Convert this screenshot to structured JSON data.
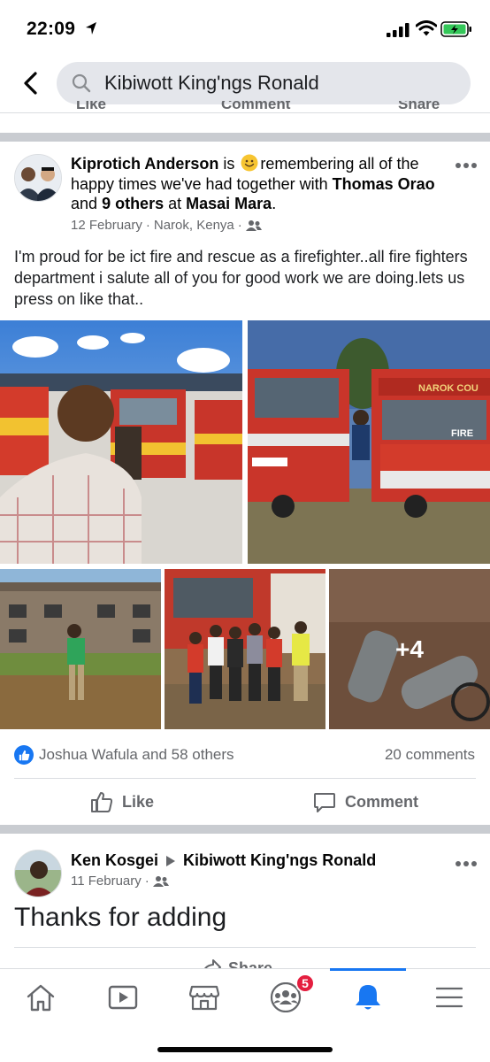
{
  "status_bar": {
    "time": "22:09"
  },
  "search": {
    "query": "Kibiwott King'ngs Ronald"
  },
  "previous_post_actions": {
    "like": "Like",
    "comment": "Comment",
    "share": "Share"
  },
  "post": {
    "author": "Kiprotich Anderson",
    "verb_is": "is",
    "feeling": "remembering all of the happy times we've had together with",
    "tagged": "Thomas Orao",
    "and_word": "and",
    "others": "9 others",
    "at_word": "at",
    "place": "Masai Mara",
    "period": ".",
    "date": "12 February",
    "location": "Narok, Kenya",
    "dot": "·",
    "body": "I'm proud  for be ict fire and rescue as a firefighter..all fire fighters  department i salute all of you for good work we are doing.lets us press on like that..",
    "photos": {
      "truck_text_1": "NAROK COU",
      "truck_text_2": "FIRE",
      "more_count": "+4"
    },
    "reactions_text": "Joshua Wafula and 58 others",
    "comments_text": "20 comments",
    "like_label": "Like",
    "comment_label": "Comment"
  },
  "post2": {
    "author": "Ken Kosgei",
    "target": "Kibiwott King'ngs Ronald",
    "date": "11 February",
    "dot": "·",
    "body": "Thanks for adding",
    "share_label": "Share"
  },
  "tabbar": {
    "groups_badge": "5",
    "tabs": [
      "home-icon",
      "watch-icon",
      "marketplace-icon",
      "groups-icon",
      "notifications-icon",
      "menu-icon"
    ]
  },
  "colors": {
    "accent": "#1877f2",
    "badge": "#e41e3f",
    "separator": "#c9ccd1",
    "search_bg": "#e4e6eb"
  }
}
